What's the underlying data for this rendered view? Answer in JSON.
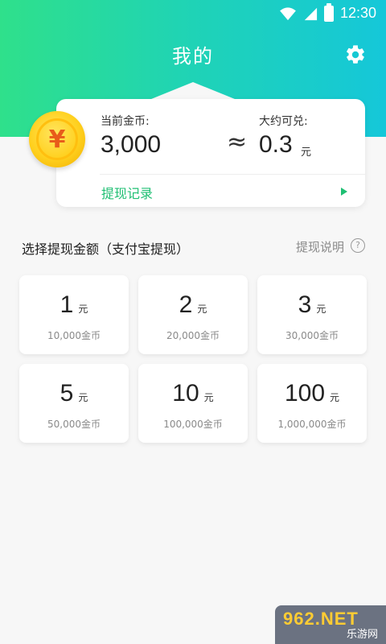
{
  "status_bar": {
    "time": "12:30"
  },
  "header": {
    "title": "我的"
  },
  "card": {
    "coin_symbol": "¥",
    "current_coins_label": "当前金币:",
    "current_coins_value": "3,000",
    "approx_symbol": "≈",
    "approx_label": "大约可兑:",
    "approx_value": "0.3",
    "approx_unit": "元",
    "record_link": "提现记录"
  },
  "section": {
    "title": "选择提现金额（支付宝提现）",
    "explain": "提现说明",
    "help_symbol": "?"
  },
  "options": [
    {
      "amount": "1",
      "unit": "元",
      "coins": "10,000金币"
    },
    {
      "amount": "2",
      "unit": "元",
      "coins": "20,000金币"
    },
    {
      "amount": "3",
      "unit": "元",
      "coins": "30,000金币"
    },
    {
      "amount": "5",
      "unit": "元",
      "coins": "50,000金币"
    },
    {
      "amount": "10",
      "unit": "元",
      "coins": "100,000金币"
    },
    {
      "amount": "100",
      "unit": "元",
      "coins": "1,000,000金币"
    }
  ],
  "watermark": {
    "main": "962.NET",
    "sub": "乐游网"
  },
  "colors": {
    "accent_green": "#1fbf73",
    "header_gradient_start": "#2fe08b",
    "header_gradient_end": "#15c7d9"
  }
}
